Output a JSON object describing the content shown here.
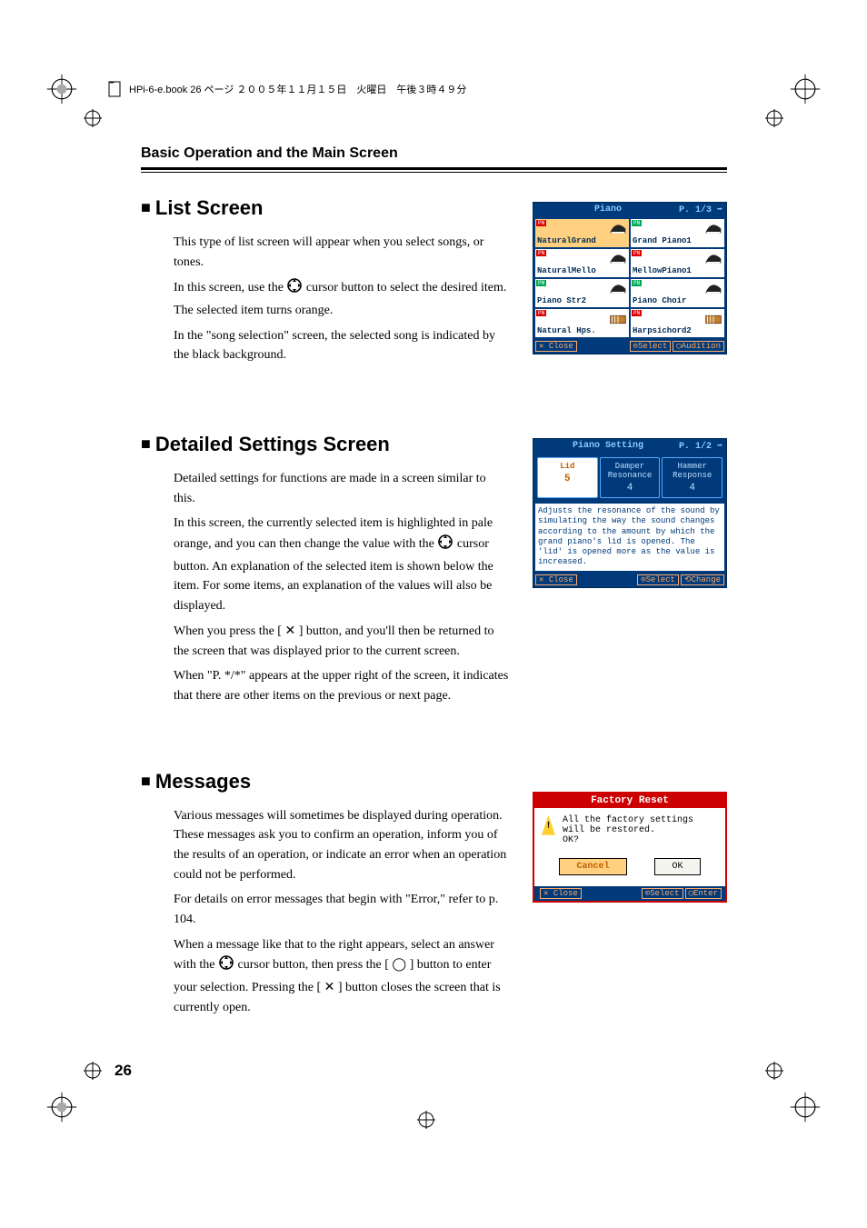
{
  "doc_header": "HPi-6-e.book 26 ページ ２００５年１１月１５日　火曜日　午後３時４９分",
  "breadcrumb": "Basic Operation and the Main Screen",
  "page_number": "26",
  "sections": {
    "list": {
      "heading": "List Screen",
      "p1": "This type of list screen will appear when you select songs, or tones.",
      "p2a": "In this screen, use the ",
      "p2b": " cursor button to select the desired item. The selected item turns orange.",
      "p3": "In the \"song selection\" screen, the selected song is indicated by the black background."
    },
    "detailed": {
      "heading": "Detailed Settings Screen",
      "p1": "Detailed settings for functions are made in a screen similar to this.",
      "p2a": "In this screen, the currently selected item is highlighted in pale orange, and you can then change the value with the ",
      "p2b": " cursor button. An explanation of the selected item is shown below the item. For some items, an explanation of the values will also be displayed.",
      "p3": "When you press the [ ✕ ] button, and you'll then be returned to the screen that was displayed prior to the current screen.",
      "p4": "When \"P. */*\" appears at the upper right of the screen, it indicates that there are other items on the previous or next page."
    },
    "messages": {
      "heading": "Messages",
      "p1": "Various messages will sometimes be displayed during operation. These messages ask you to confirm an operation, inform you of the results of an operation, or indicate an error when an operation could not be performed.",
      "p2": "For details on error messages that begin with \"Error,\" refer to p. 104.",
      "p3a": "When a message like that to the right appears, select an answer with the ",
      "p3b": " cursor button, then press the [ ◯ ] button to enter your selection. Pressing the [ ✕ ] button closes the screen that is currently open."
    }
  },
  "fig_piano": {
    "title": "Piano",
    "page_ind": "P. 1/3 ➡",
    "items": [
      {
        "tag": "PN",
        "name": "NaturalGrand",
        "sel": true,
        "icon": "grand"
      },
      {
        "tag": "PN",
        "name": "Grand Piano1",
        "icon": "grand",
        "tag_color": "green"
      },
      {
        "tag": "PN",
        "name": "NaturalMello",
        "icon": "grand"
      },
      {
        "tag": "PN",
        "name": "MellowPiano1",
        "icon": "grand"
      },
      {
        "tag": "PN",
        "name": "Piano Str2",
        "icon": "grand-str",
        "tag_color": "green"
      },
      {
        "tag": "PN",
        "name": "Piano Choir",
        "icon": "grand-str",
        "tag_color": "green"
      },
      {
        "tag": "PN",
        "name": "Natural Hps.",
        "icon": "harpsi"
      },
      {
        "tag": "PN",
        "name": "Harpsichord2",
        "icon": "harpsi"
      }
    ],
    "footer": {
      "close": "✕ Close",
      "select": "⊙Select",
      "audition": "◯Audition"
    }
  },
  "fig_setting": {
    "title": "Piano Setting",
    "page_ind": "P. 1/2 ➡",
    "boxes": [
      {
        "name": "Lid",
        "value": "5",
        "sel": true
      },
      {
        "name": "Damper Resonance",
        "value": "4"
      },
      {
        "name": "Hammer Response",
        "value": "4"
      }
    ],
    "desc": "Adjusts the resonance of the sound by simulating the way the sound changes according to the amount by which the grand piano's lid is opened. The 'lid' is opened more as the value is increased.",
    "footer": {
      "close": "✕ Close",
      "select": "⊙Select",
      "change": "⟲Change"
    }
  },
  "fig_message": {
    "title": "Factory Reset",
    "body": "All the factory settings will be restored.\nOK?",
    "cancel": "Cancel",
    "ok": "OK",
    "footer": {
      "close": "✕ Close",
      "select": "⊙Select",
      "enter": "◯Enter"
    }
  }
}
